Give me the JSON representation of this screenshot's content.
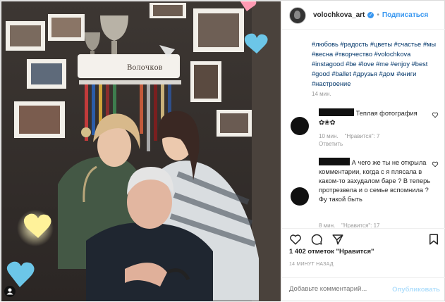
{
  "header": {
    "username": "volochkova_art",
    "separator": "•",
    "follow_label": "Подписаться"
  },
  "caption": {
    "hashtags": "#любовь #радость #цветы #счастье #мы #весна #творчество #volochkova #instagood #be #love #me #enjoy #best #good #ballet #друзья #дом #книги #настроение",
    "time": "14 мин."
  },
  "comments": [
    {
      "text": "Теплая фотография",
      "emoji": "✿❀✿",
      "time": "10 мин.",
      "likes": "\"Нравится\": 7",
      "reply": "Ответить"
    },
    {
      "text": "А чего же ты не открыла комментарии, когда с  я плясала в каком-то захудалом баре ? В теперь протрезвела и о семье вспомнила ? Фу такой быть",
      "time": "8 мин.",
      "likes": "\"Нравится\": 17"
    }
  ],
  "photo": {
    "sign_text": "Волочков"
  },
  "likes_text": "1 402 отметок \"Нравится\"",
  "post_time": "14 МИНУТ НАЗАД",
  "add_comment": {
    "placeholder": "Добавьте комментарий...",
    "publish_label": "Опубликовать"
  },
  "colors": {
    "link_blue": "#3897f0",
    "hashtag": "#003569",
    "muted": "#999999",
    "publish_disabled": "#b2dffc"
  },
  "icons": [
    "heart-icon",
    "comment-icon",
    "share-icon",
    "bookmark-icon",
    "verified-badge-icon",
    "user-tag-icon"
  ]
}
